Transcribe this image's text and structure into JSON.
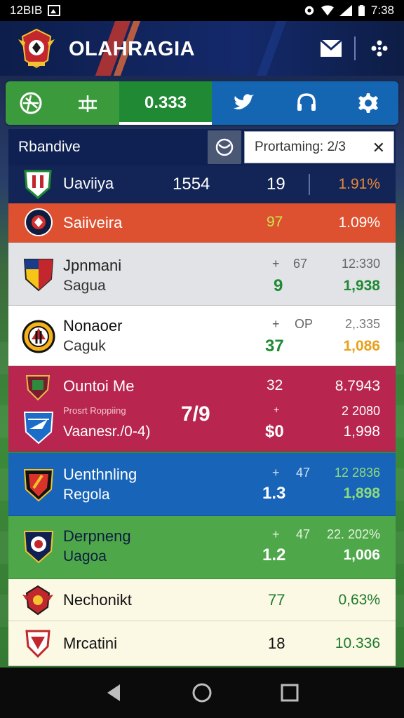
{
  "status_bar": {
    "time_left": "12BIB",
    "time_right": "7:38"
  },
  "header": {
    "title": "OLAHRAGIA",
    "icons": [
      "club-crest-icon",
      "mail-icon",
      "more-icon"
    ]
  },
  "tabs": [
    {
      "icon": "ball-icon"
    },
    {
      "icon": "pitch-icon"
    },
    {
      "label": "0.333",
      "active": true
    },
    {
      "icon": "bird-icon"
    },
    {
      "icon": "headset-icon"
    },
    {
      "icon": "gear-icon"
    }
  ],
  "board": {
    "title": "Rbandive",
    "search_value": "Prortaming: 2/3"
  },
  "rows": [
    {
      "name": "Uaviiya",
      "mid": "1554",
      "score": "19",
      "pct": "1.91%"
    },
    {
      "name": "Saiiveira",
      "score": "97",
      "pct": "1.09%"
    },
    {
      "name": "Jpnmani",
      "sub": "Sagua",
      "small_mid": "67",
      "small_pct": "12:330",
      "score": "9",
      "pct": "1,938"
    },
    {
      "name": "Nonaoer",
      "sub": "Caguk",
      "small_mid": "OP",
      "small_pct": "2,.335",
      "score": "37",
      "pct": "1,086"
    },
    {
      "name": "Ountoi Me",
      "sub_small": "Prosrt Roppiing",
      "sub": "Vaanesr./0-4)",
      "center": "7/9",
      "score_top": "32",
      "pct_top": "8.7943",
      "small_pct": "2 2080",
      "score": "$0",
      "pct": "1,998"
    },
    {
      "name": "Uenthnling",
      "sub": "Regola",
      "small_mid": "47",
      "small_pct": "12 2836",
      "score": "1.3",
      "pct": "1,898"
    },
    {
      "name": "Derpneng",
      "sub": "Uagoa",
      "small_mid": "47",
      "small_pct": "22. 202%",
      "score": "1.2",
      "pct": "1,006"
    },
    {
      "name": "Nechonikt",
      "score": "77",
      "pct": "0,63%"
    },
    {
      "name": "Mrcatini",
      "score": "18",
      "pct": "10.336"
    }
  ],
  "nav": {
    "icons": [
      "back-icon",
      "home-icon",
      "recents-icon"
    ]
  }
}
